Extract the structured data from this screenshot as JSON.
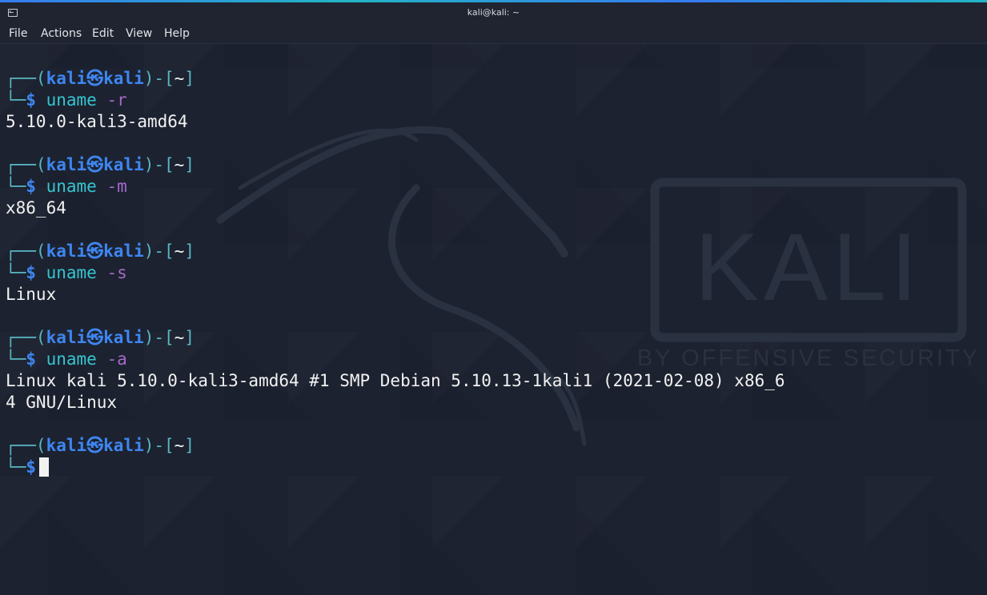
{
  "window": {
    "title": "kali@kali: ~"
  },
  "menu": {
    "items": [
      "File",
      "Actions",
      "Edit",
      "View",
      "Help"
    ]
  },
  "prompt": {
    "open": "┌──(",
    "user": "kali㉿kali",
    "close": ")-[",
    "dir": "~",
    "end": "]",
    "second_line": "└─",
    "symbol": "$"
  },
  "watermark": {
    "brand": "KALI",
    "tagline": "BY OFFENSIVE SECURITY"
  },
  "session": {
    "blocks": [
      {
        "cmd": "uname",
        "arg": "-r",
        "output": [
          "5.10.0-kali3-amd64"
        ]
      },
      {
        "cmd": "uname",
        "arg": "-m",
        "output": [
          "x86_64"
        ]
      },
      {
        "cmd": "uname",
        "arg": "-s",
        "output": [
          "Linux"
        ]
      },
      {
        "cmd": "uname",
        "arg": "-a",
        "output": [
          "Linux kali 5.10.0-kali3-amd64 #1 SMP Debian 5.10.13-1kali1 (2021-02-08) x86_6",
          "4 GNU/Linux"
        ]
      }
    ]
  },
  "colors": {
    "prompt_box": "#59b7c2",
    "prompt_user": "#3e86f0",
    "command": "#36c5cf",
    "argument": "#a569c9",
    "output": "#f2f2f2",
    "background": "#1c2230"
  },
  "icons": {
    "window": "terminal-window-icon"
  }
}
